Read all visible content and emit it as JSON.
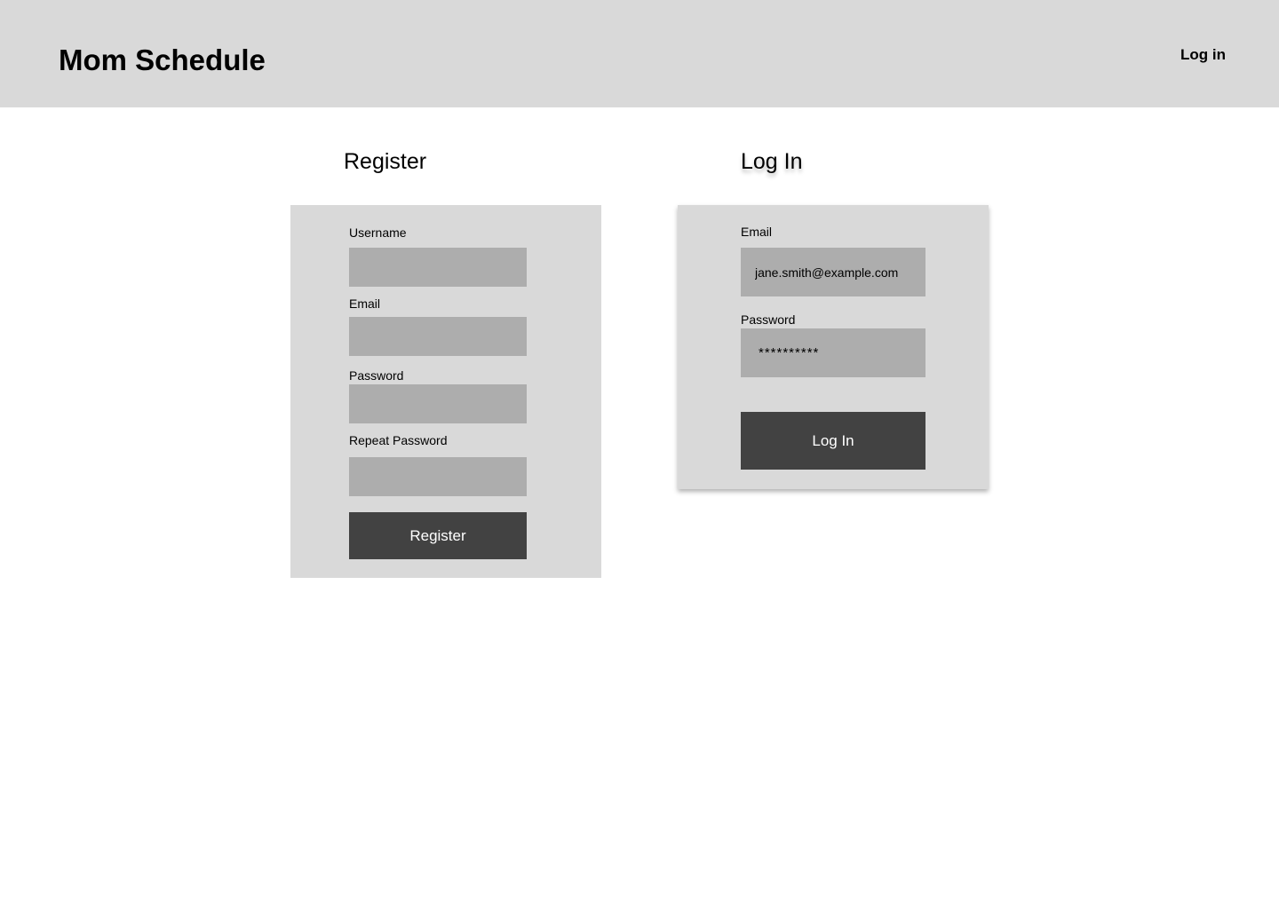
{
  "header": {
    "app_title": "Mom Schedule",
    "login_link": "Log in"
  },
  "register": {
    "heading": "Register",
    "username_label": "Username",
    "username_value": "",
    "email_label": "Email",
    "email_value": "",
    "password_label": "Password",
    "password_value": "",
    "repeat_password_label": "Repeat Password",
    "repeat_password_value": "",
    "submit_label": "Register"
  },
  "login": {
    "heading": "Log In",
    "email_label": "Email",
    "email_value": "jane.smith@example.com",
    "password_label": "Password",
    "password_value": "**********",
    "submit_label": "Log In"
  },
  "colors": {
    "header_bg": "#d9d9d9",
    "panel_bg": "#d9d9d9",
    "input_bg": "#adadad",
    "button_bg": "#424242",
    "button_text": "#ffffff"
  }
}
